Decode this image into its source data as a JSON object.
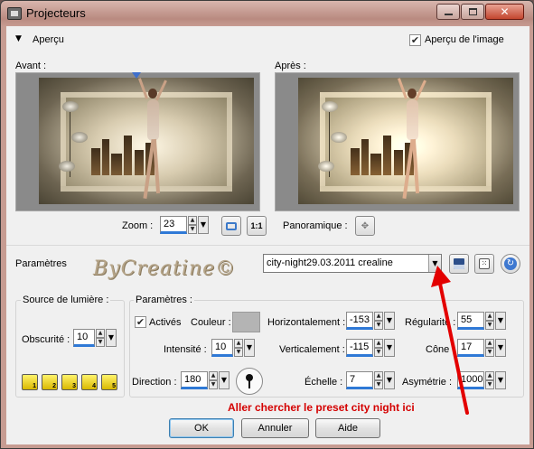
{
  "window": {
    "title": "Projecteurs"
  },
  "top": {
    "section_label": "Aperçu",
    "preview_checkbox_label": "Aperçu de l'image",
    "preview_checked": true
  },
  "previews": {
    "before_label": "Avant :",
    "after_label": "Après :"
  },
  "zoom": {
    "label": "Zoom :",
    "value": "23",
    "one_to_one": "1:1",
    "pan_label": "Panoramique :"
  },
  "params": {
    "label": "Paramètres",
    "preset_value": "city-night29.03.2011 crealine",
    "signature": "ByCreatine©"
  },
  "light_source": {
    "title": "Source de lumière :",
    "obscurity_label": "Obscurité :",
    "obscurity_value": "10",
    "lights": [
      "1",
      "2",
      "3",
      "4",
      "5"
    ]
  },
  "settings": {
    "title": "Paramètres :",
    "active_label": "Activés",
    "active_checked": true,
    "color_label": "Couleur :",
    "color_value": "#b4b4b4",
    "intensity_label": "Intensité :",
    "intensity_value": "10",
    "direction_label": "Direction :",
    "direction_value": "180",
    "horizontal_label": "Horizontalement :",
    "horizontal_value": "-153",
    "vertical_label": "Verticalement :",
    "vertical_value": "-115",
    "scale_label": "Échelle :",
    "scale_value": "7",
    "regularity_label": "Régularité :",
    "regularity_value": "55",
    "cone_label": "Cône :",
    "cone_value": "17",
    "asymmetry_label": "Asymétrie :",
    "asymmetry_value": "1000"
  },
  "annotation": {
    "text": "Aller chercher le preset city night ici",
    "color": "#d40000"
  },
  "buttons": {
    "ok": "OK",
    "cancel": "Annuler",
    "help": "Aide"
  }
}
